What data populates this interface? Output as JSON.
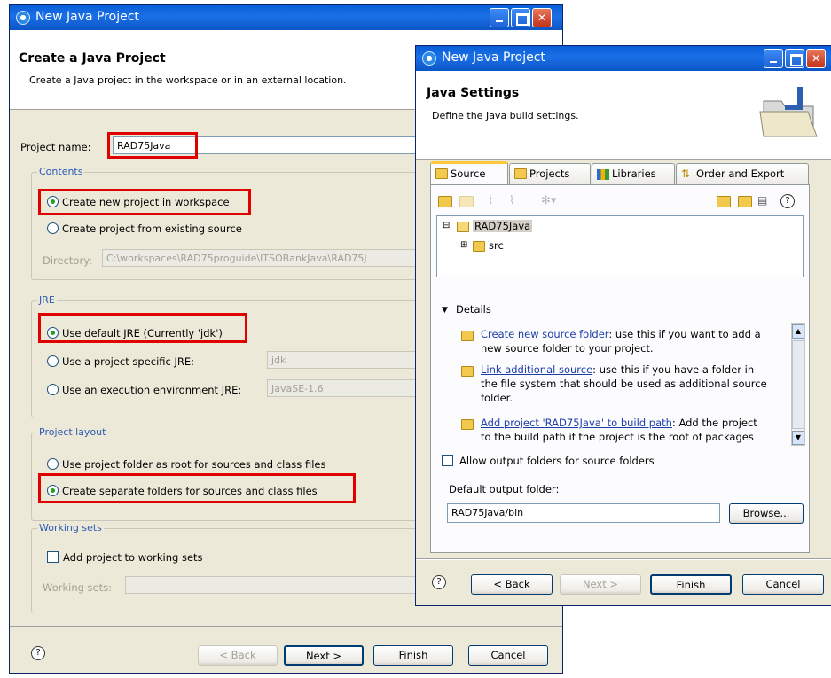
{
  "back_window": {
    "title": "New Java Project",
    "header_title": "Create a Java Project",
    "header_desc": "Create a Java project in the workspace or in an external location.",
    "project_name_label": "Project name:",
    "project_name_value": "RAD75Java",
    "contents": {
      "label": "Contents",
      "opt_new": "Create new project in workspace",
      "opt_existing": "Create project from existing source",
      "directory_label": "Directory:",
      "directory_value": "C:\\workspaces\\RAD75proguide\\ITSOBankJava\\RAD75J"
    },
    "jre": {
      "label": "JRE",
      "opt_default": "Use default JRE (Currently 'jdk')",
      "opt_specific": "Use a project specific JRE:",
      "specific_value": "jdk",
      "opt_env": "Use an execution environment JRE:",
      "env_value": "JavaSE-1.6"
    },
    "layout": {
      "label": "Project layout",
      "opt_root": "Use project folder as root for sources and class files",
      "opt_separate": "Create separate folders for sources and class files"
    },
    "working_sets": {
      "label": "Working sets",
      "add_label": "Add project to working sets",
      "sets_label": "Working sets:"
    },
    "buttons": {
      "back": "< Back",
      "next": "Next >",
      "finish": "Finish",
      "cancel": "Cancel"
    }
  },
  "front_window": {
    "title": "New Java Project",
    "header_title": "Java Settings",
    "header_desc": "Define the Java build settings.",
    "tabs": [
      "Source",
      "Projects",
      "Libraries",
      "Order and Export"
    ],
    "tree": {
      "project": "RAD75Java",
      "child": "src"
    },
    "details_label": "Details",
    "details": {
      "create_link": "Create new source folder",
      "create_text_1": ": use this if you want to add a",
      "create_text_2": "new source folder to your project.",
      "link_link": "Link additional source",
      "link_text_1": ": use this if you have a folder in",
      "link_text_2": "the file system that should be used as additional source",
      "link_text_3": "folder.",
      "add_link": "Add project 'RAD75Java' to build path",
      "add_text_1": ": Add the project",
      "add_text_2": "to the build path if the project is the root of packages"
    },
    "allow_output_label": "Allow output folders for source folders",
    "default_output_label": "Default output folder:",
    "default_output_value": "RAD75Java/bin",
    "browse": "Browse...",
    "buttons": {
      "back": "< Back",
      "next": "Next >",
      "finish": "Finish",
      "cancel": "Cancel"
    }
  },
  "colors": {
    "highlight_box": "#e00000",
    "titlebar": "#0a5ed8",
    "group_label": "#2b5bb5",
    "link": "#1a3da6"
  }
}
